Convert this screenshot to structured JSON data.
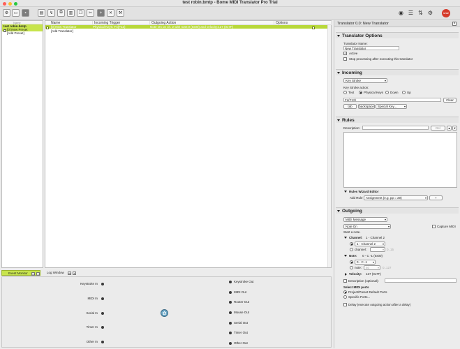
{
  "window": {
    "title": "test robin.bmtp - Bome MIDI Translator Pro Trial",
    "traffic_lights": [
      "#ff5f57",
      "#febc2e",
      "#28c840"
    ]
  },
  "toolbar": {
    "icons": [
      "settings-icon",
      "open-icon",
      "save-icon",
      "add-preset-icon",
      "add-translator-icon",
      "copy-icon",
      "paste-icon",
      "duplicate-icon",
      "cut-icon",
      "new-translator-icon",
      "delete-icon",
      "tools-icon"
    ],
    "right_icons": [
      "midi-ports-icon",
      "list-icon",
      "routing-icon",
      "gear-icon"
    ],
    "stop_label": "STOP"
  },
  "project_tree": {
    "header": "Name",
    "project": "test robin.bmtp",
    "preset": "[0] New Preset",
    "add_preset": "[Add Preset]"
  },
  "translator_list": {
    "columns": [
      "Name",
      "Incoming Trigger",
      "Outgoing Action",
      "Options"
    ],
    "rows": [
      {
        "name": "[0] New Translator",
        "incoming": "Physical Keys: Fn(F12)",
        "outgoing": "Note On on ch. 2 with note:0 (0x00) and velocity:127 (0x7F)",
        "options": ""
      }
    ],
    "add_translator": "[Add Translator]"
  },
  "bottom_tabs": {
    "event_monitor": "Event Monitor",
    "log_window": "Log Window"
  },
  "event_monitor": {
    "inputs": [
      "Keystroke In",
      "MIDI In",
      "Serial In",
      "Timer In",
      "Other In"
    ],
    "outputs": [
      "Keystroke Out",
      "MIDI Out",
      "Router Out",
      "Mouse Out",
      "Serial Out",
      "Timer Out",
      "Other Out"
    ]
  },
  "right_panel": {
    "title": "Translator 0.0: New Translator",
    "options": {
      "heading": "Translator Options",
      "name_label": "Translator Name:",
      "name_value": "New Translator",
      "active_label": "Active",
      "active_checked": true,
      "stop_label": "Stop processing after executing this translator",
      "stop_checked": false
    },
    "incoming": {
      "heading": "Incoming",
      "type": "Key Stroke",
      "action_label": "Key Stroke action:",
      "radio_options": [
        "Text",
        "Physical Keys",
        "Down",
        "Up"
      ],
      "selected_radio": "Physical Keys",
      "key_value": "Fn(F12)",
      "clear_label": "Clear",
      "tab_label": "tab",
      "backspace_label": "backspace",
      "special_key": "Special Key..."
    },
    "rules": {
      "heading": "Rules",
      "description_label": "Description:",
      "del_label": "Del",
      "up_label": "▴",
      "down_label": "▾",
      "wizard_heading": "Rules Wizard Editor",
      "add_rule_label": "Add Rule",
      "add_rule_select": "Assignment (e.g. pp = 20)",
      "add_btn": "+"
    },
    "outgoing": {
      "heading": "Outgoing",
      "type": "MIDI Message",
      "message": "Note On",
      "capture_label": "Capture MIDI",
      "start_note": "Start a note.",
      "channel_label": "Channel:",
      "channel_value": "1 - Channel 2",
      "channel_select": "1 - Channel 2",
      "channel_var": "channel:",
      "channel_range": "0..15",
      "note_label": "Note:",
      "note_value": "0 - C -1 (0x00)",
      "note_select": "0 - C -1",
      "note_var": "note:",
      "note_var_value": "60",
      "note_range": "0..127",
      "velocity_label": "Velocity:",
      "velocity_value": "127 (0x7F)",
      "description_label": "Description (optional):",
      "ports_heading": "Select MIDI ports",
      "port_option1": "Project/Preset Default Ports",
      "port_option2": "Specific Ports...",
      "delay_label": "Delay (execute outgoing action after a delay)"
    }
  }
}
